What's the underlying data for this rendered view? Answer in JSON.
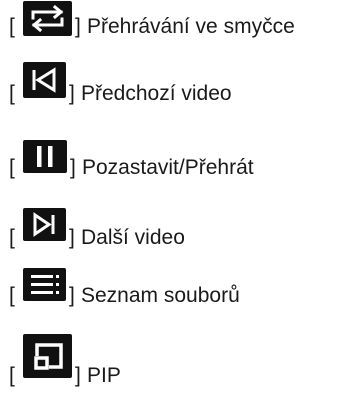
{
  "legend": {
    "open_bracket": "[",
    "close_bracket": "]",
    "items": [
      {
        "icon": "loop-icon",
        "label": "Přehrávání ve smyčce"
      },
      {
        "icon": "previous-video-icon",
        "label": "Předchozí video"
      },
      {
        "icon": "pause-play-icon",
        "label": "Pozastavit/Přehrát"
      },
      {
        "icon": "next-video-icon",
        "label": "Další video"
      },
      {
        "icon": "file-list-icon",
        "label": "Seznam souborů"
      },
      {
        "icon": "pip-icon",
        "label": "PIP"
      }
    ]
  }
}
